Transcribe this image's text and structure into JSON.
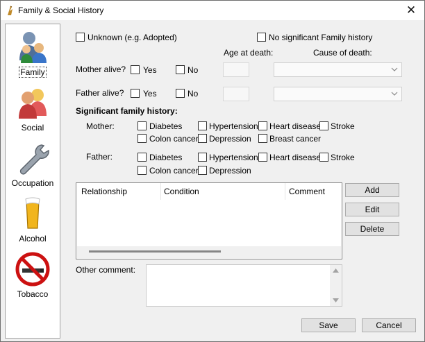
{
  "window": {
    "title": "Family & Social History"
  },
  "sidebar": {
    "items": [
      {
        "label": "Family",
        "icon": "family-icon"
      },
      {
        "label": "Social",
        "icon": "social-icon"
      },
      {
        "label": "Occupation",
        "icon": "wrench-icon"
      },
      {
        "label": "Alcohol",
        "icon": "beer-icon"
      },
      {
        "label": "Tobacco",
        "icon": "no-smoking-icon"
      }
    ]
  },
  "family": {
    "unknown_label": "Unknown (e.g. Adopted)",
    "no_significant_label": "No significant Family history",
    "age_at_death_label": "Age at death:",
    "cause_of_death_label": "Cause of death:",
    "mother_alive_label": "Mother alive?",
    "father_alive_label": "Father alive?",
    "yes_label": "Yes",
    "no_label": "No",
    "significant_history_label": "Significant family history:",
    "mother_label": "Mother:",
    "father_label": "Father:",
    "mother_conditions": [
      "Diabetes",
      "Hypertension",
      "Heart disease",
      "Stroke",
      "Colon cancer",
      "Depression",
      "Breast cancer"
    ],
    "father_conditions": [
      "Diabetes",
      "Hypertension",
      "Heart disease",
      "Stroke",
      "Colon cancer",
      "Depression"
    ]
  },
  "table": {
    "columns": [
      "Relationship",
      "Condition",
      "Comment"
    ]
  },
  "buttons": {
    "add": "Add",
    "edit": "Edit",
    "delete": "Delete",
    "save": "Save",
    "cancel": "Cancel"
  },
  "other_comment_label": "Other comment:",
  "colors": {
    "accent": "#0078d7",
    "border": "#a0a0a0"
  }
}
